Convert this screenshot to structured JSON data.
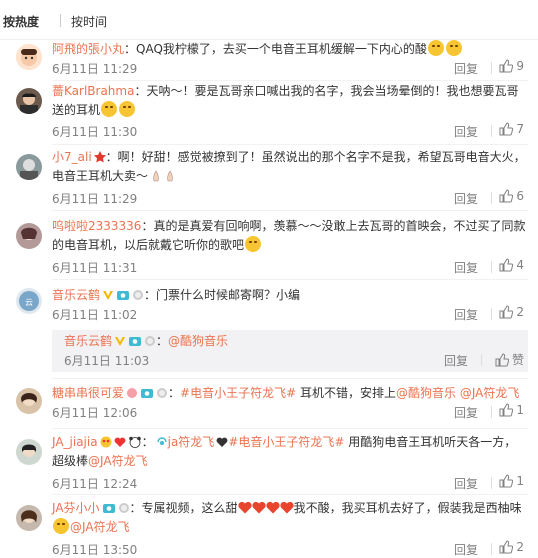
{
  "sort": {
    "hot": "按热度",
    "time": "按时间"
  },
  "actions": {
    "reply": "回复",
    "like_zero": "赞"
  },
  "colors": {
    "accent": "#eb7350",
    "meta": "#808080",
    "subbg": "#f2f2f5"
  },
  "comments": [
    {
      "user": "阿飛的張小丸",
      "text": "：QAQ我柠檬了，去买一个电音王耳机缓解一下内心的酸",
      "emoji": [
        "lemon-face-emoji",
        "lemon-face-emoji"
      ],
      "time": "6月11日 11:29",
      "likes": "9"
    },
    {
      "user": "薔KarlBrahma",
      "text": "：天呐～！要是瓦哥亲口喊出我的名字，我会当场晕倒的！我也想要瓦哥送的耳机",
      "emoji": [
        "cry-emoji",
        "cry-emoji"
      ],
      "time": "6月11日 11:30",
      "likes": "7"
    },
    {
      "user": "小7_ali",
      "text": "：啊！好甜！感觉被撩到了！虽然说出的那个名字不是我，希望瓦哥电音大火，电音王耳机大卖～",
      "emoji": [
        "praying-emoji",
        "praying-emoji"
      ],
      "time": "6月11日 11:29",
      "likes": "6"
    },
    {
      "user": "呜啦啦2333336",
      "text": "：真的是真爱有回响啊，羡慕～～没敢上去瓦哥的首映会，不过买了同款的电音耳机，以后就戴它听你的歌吧",
      "emoji": [
        "smile-emoji"
      ],
      "time": "6月11日 11:31",
      "likes": "4"
    },
    {
      "user": "音乐云鹤",
      "text": "：门票什么时候邮寄啊？小编",
      "time": "6月11日 11:02",
      "likes": "2",
      "reply": {
        "user": "音乐云鹤",
        "prefix": "：",
        "mention": "@酷狗音乐",
        "time": "6月11日 11:03"
      }
    },
    {
      "user": "糖串串很可爱",
      "prefix": "：",
      "hashtag": "#电音小王子符龙飞#",
      "text": " 耳机不错，安排上",
      "mention1": "@酷狗音乐",
      "mention2": "@JA符龙飞",
      "time": "6月11日 12:06",
      "likes": "1"
    },
    {
      "user": "JA_jiajia",
      "prefix": "：",
      "mention1": "ja符龙飞",
      "hashtag": "#电音小王子符龙飞#",
      "text": " 用酷狗电音王耳机听天各一方，超级棒",
      "mention2": "@JA符龙飞",
      "time": "6月11日 12:24",
      "likes": "1"
    },
    {
      "user": "JA芬小小",
      "text": "：专属视频，这么甜",
      "text2": "我不酸，我买耳机去好了，假装我是西柚味",
      "mention": "@JA符龙飞",
      "time": "6月11日 13:50",
      "likes": "2"
    }
  ]
}
